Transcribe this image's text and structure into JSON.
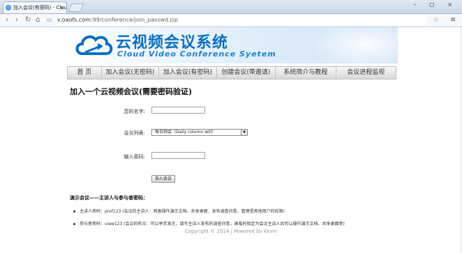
{
  "browser": {
    "tab_title": "加入会议(有密码) - Clou",
    "tab_close": "×",
    "window_buttons": "– ▢ ×",
    "url_host": "v.oaofs.com",
    "url_path": ":99/conference/join_passwd.jsp",
    "nav_back": "‹",
    "nav_forward": "›",
    "nav_reload": "↻",
    "nav_home": "⌂",
    "star": "☆",
    "menu": "≡"
  },
  "banner": {
    "title_cn": "云视频会议系统",
    "title_en": "Cloud Video Conference Syetem"
  },
  "nav": {
    "items": [
      {
        "label": "首 页"
      },
      {
        "label": "加入会议(无密码)"
      },
      {
        "label": "加入会议(有密码)"
      },
      {
        "label": "创建会议(带邀请)"
      },
      {
        "label": "系统简介与教程"
      },
      {
        "label": "会议进程监视"
      }
    ]
  },
  "page": {
    "heading": "加入一个云视频会议(需要密码验证)"
  },
  "form": {
    "name_label": "您的名字:",
    "name_value": "",
    "list_label": "会议列表:",
    "list_selected": "每日例会（Daily column will）",
    "password_label": "输入密码:",
    "password_value": "",
    "join_button": "加入会议"
  },
  "demo": {
    "title": "演示会议——主讲人与参与者密码：",
    "items": [
      "主讲人密码：prof123 (会议的主讲人：具备操作演示文档、共享桌面、发布调查问卷、管理里其他用户的权限)",
      "参与者密码：view123 (会议的听众：可以举手发言，填写主讲人发布的调查问卷，被临时指定为会议主讲人后可以操作演示文档、共享桌面等)"
    ]
  },
  "footer": {
    "text": "Copyright © 2014  |  Powered by Kevin"
  }
}
